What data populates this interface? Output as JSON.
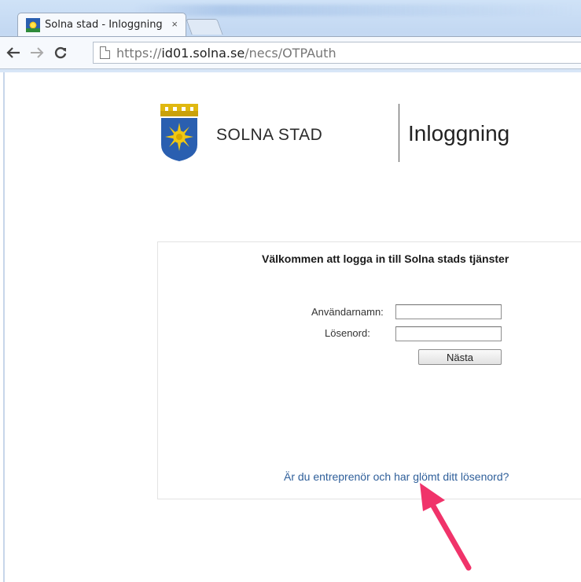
{
  "browser": {
    "tab_title": "Solna stad - Inloggning",
    "tab_close": "×",
    "url_prefix": "https://",
    "url_host": "id01.solna.se",
    "url_path": "/necs/OTPAuth",
    "icons": [
      "back-icon",
      "forward-icon",
      "reload-icon",
      "page-icon"
    ]
  },
  "header": {
    "brand": "SOLNA STAD",
    "title": "Inloggning"
  },
  "login": {
    "welcome": "Välkommen att logga in till Solna stads tjänster",
    "username_label": "Användarnamn:",
    "username_value": "",
    "password_label": "Lösenord:",
    "password_value": "",
    "next_button": "Nästa",
    "forgot_link": "Är du entreprenör och har glömt ditt lösenord?"
  },
  "colors": {
    "link": "#2f5f9a",
    "annotation_arrow": "#f0336a",
    "crest_blue": "#2a5fb0",
    "crest_gold": "#f2c811"
  }
}
